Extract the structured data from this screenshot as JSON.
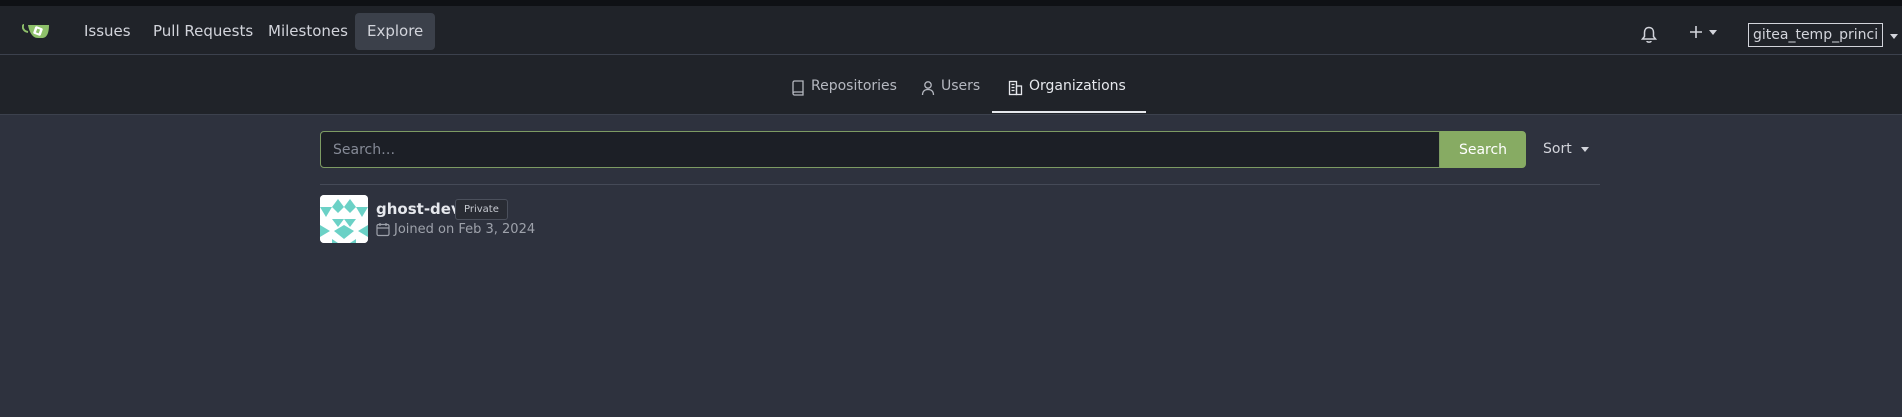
{
  "nav": {
    "items": [
      {
        "label": "Issues"
      },
      {
        "label": "Pull Requests"
      },
      {
        "label": "Milestones"
      },
      {
        "label": "Explore"
      }
    ],
    "user_avatar_alt": "gitea_temp_princi"
  },
  "tabs": [
    {
      "label": "Repositories",
      "icon": "repo-icon"
    },
    {
      "label": "Users",
      "icon": "person-icon"
    },
    {
      "label": "Organizations",
      "icon": "organization-icon"
    }
  ],
  "search": {
    "placeholder": "Search…",
    "value": "",
    "button_label": "Search",
    "sort_label": "Sort"
  },
  "organizations": [
    {
      "name": "ghost-dev",
      "badge": "Private",
      "joined": "Joined on Feb 3, 2024"
    }
  ],
  "colors": {
    "accent": "#87ab63",
    "background": "#2e323e",
    "navbar": "#202329"
  }
}
